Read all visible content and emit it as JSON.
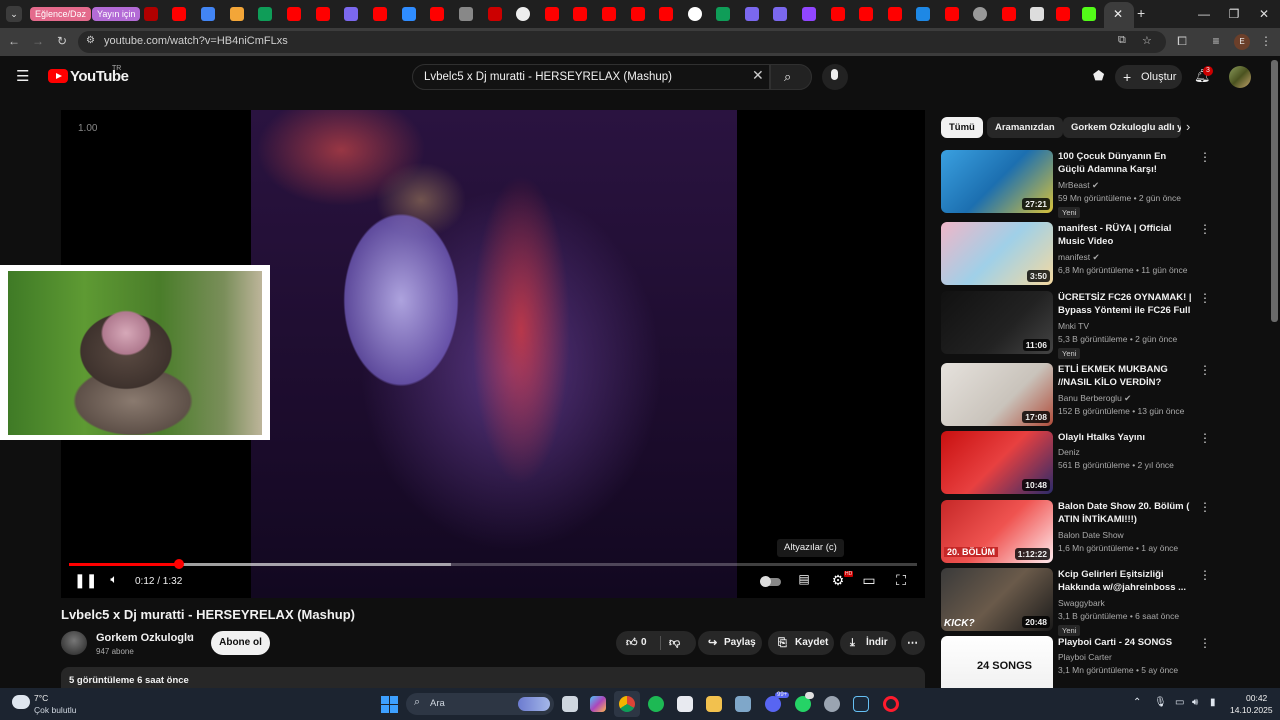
{
  "browser": {
    "tab_groups": [
      "Eğlence/Dəz",
      "Yayın için"
    ],
    "url": "youtube.com/watch?v=HB4niCmFLxs",
    "profile_initial": "E",
    "window_controls": [
      "minimize-icon",
      "maximize-icon",
      "close-icon"
    ]
  },
  "masthead": {
    "logo_text": "YouTube",
    "region": "TR",
    "search_query": "Lvbelc5 x Dj muratti - HERSEYRELAX (Mashup)",
    "create_label": "Oluştur",
    "notification_count": "3"
  },
  "player": {
    "speed_overlay": "1.00",
    "time": "0:12 / 1:32",
    "progress_fraction": 0.13,
    "buffer_fraction": 0.45,
    "tooltip": "Altyazılar (c)",
    "hd_badge": "HD"
  },
  "video": {
    "title": "Lvbelc5 x Dj muratti - HERSEYRELAX (Mashup)",
    "channel": "Gorkem Ozkuloglu",
    "subscribers": "947 abone",
    "subscribe_label": "Abone ol",
    "likes": "0",
    "share_label": "Paylaş",
    "save_label": "Kaydet",
    "download_label": "İndir",
    "meta": "5 görüntüleme  6 saat önce"
  },
  "chips": [
    "Tümü",
    "Aramanızdan",
    "Gorkem Ozkuloglu adlı y"
  ],
  "recommendations": [
    {
      "title": "100 Çocuk Dünyanın En Güçlü Adamına Karşı!",
      "channel": "MrBeast",
      "verified": true,
      "meta": "59 Mn görüntüleme • 2 gün önce",
      "duration": "27:21",
      "new": "Yeni"
    },
    {
      "title": "manifest - RÜYA | Official Music Video",
      "channel": "manifest",
      "verified": true,
      "meta": "6,8 Mn görüntüleme • 11 gün önce",
      "duration": "3:50",
      "new": ""
    },
    {
      "title": "ÜCRETSİZ FC26 OYNAMAK! | Bypass Yöntemi ile FC26 Full ...",
      "channel": "Mnki TV",
      "verified": false,
      "meta": "5,3 B görüntüleme • 2 gün önce",
      "duration": "11:06",
      "new": "Yeni"
    },
    {
      "title": "ETLİ EKMEK MUKBANG //NASIL KİLO VERDİN?",
      "channel": "Banu Berberoglu",
      "verified": true,
      "meta": "152 B görüntüleme • 13 gün önce",
      "duration": "17:08",
      "new": ""
    },
    {
      "title": "Olaylı Htalks Yayını",
      "channel": "Deniz",
      "verified": false,
      "meta": "561 B görüntüleme • 2 yıl önce",
      "duration": "10:48",
      "new": ""
    },
    {
      "title": "Balon Date Show 20. Bölüm ( ATIN İNTİKAMI!!!)",
      "channel": "Balon Date Show",
      "verified": false,
      "meta": "1,6 Mn görüntüleme • 1 ay önce",
      "duration": "1:12:22",
      "new": ""
    },
    {
      "title": "Kcip Gelirleri Eşitsizliği Hakkında w/@jahreinboss ...",
      "channel": "Swaggybark",
      "verified": false,
      "meta": "3,1 B görüntüleme • 6 saat önce",
      "duration": "20:48",
      "new": "Yeni"
    },
    {
      "title": "Playboi Carti - 24 SONGS",
      "channel": "Playboi Carter",
      "verified": false,
      "meta": "3,1 Mn görüntüleme • 5 ay önce",
      "duration": "",
      "new": ""
    }
  ],
  "thumb_texts": {
    "bolum": "20. BÖLÜM",
    "kick": "KICK?",
    "songs": "24 SONGS"
  },
  "taskbar": {
    "temp": "7°C",
    "weather": "Çok bulutlu",
    "search_label": "Ara",
    "time": "00:42",
    "date": "14.10.2025",
    "discord_badge": "99+"
  }
}
